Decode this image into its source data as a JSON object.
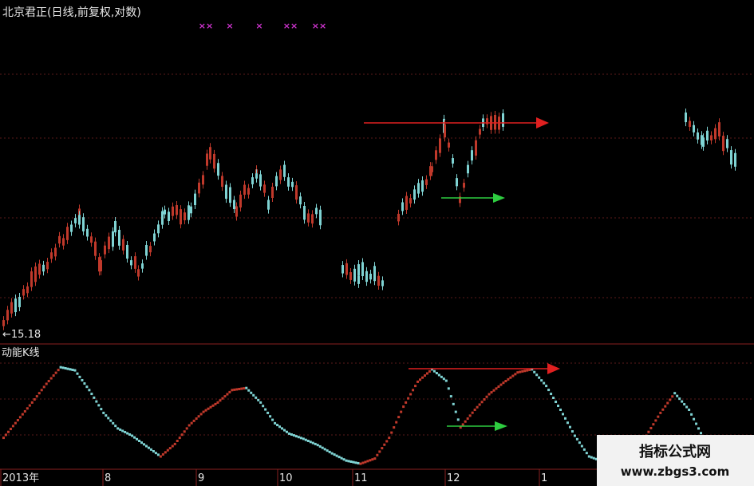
{
  "header": {
    "title": "北京君正(日线,前复权,对数)",
    "markers": [
      "××",
      "×",
      "×",
      "××",
      "××"
    ]
  },
  "main_panel": {
    "low_price_label": "←15.18"
  },
  "indicator_panel": {
    "title": "动能K线"
  },
  "x_axis": {
    "labels": [
      "2013年",
      "8",
      "9",
      "10",
      "11",
      "12",
      "1"
    ]
  },
  "watermark": {
    "text": "指标公式网",
    "url": "www.zbgs3.com"
  },
  "colors": {
    "background": "#000000",
    "up": "#c0392b",
    "down": "#7fd3d3",
    "arrow_red": "#e02020",
    "arrow_green": "#2ecc40",
    "marker": "#cc33cc"
  },
  "chart_data": [
    {
      "type": "candlestick",
      "title": "北京君正(日线,前复权,对数)",
      "x_labels": [
        "2013年",
        "8",
        "9",
        "10",
        "11",
        "12",
        "1"
      ],
      "annotations": [
        "←15.18"
      ],
      "note_arrows": [
        "resistance (red, right)",
        "support (green, right)"
      ]
    },
    {
      "type": "line",
      "title": "动能K线",
      "series": [
        {
          "values": [
            0.28,
            0.45,
            0.62,
            0.8,
            0.96,
            0.93,
            0.74,
            0.52,
            0.37,
            0.3,
            0.2,
            0.1,
            0.22,
            0.4,
            0.53,
            0.62,
            0.74,
            0.76,
            0.62,
            0.42,
            0.32,
            0.27,
            0.21,
            0.13,
            0.06,
            0.03,
            0.08,
            0.28,
            0.58,
            0.82,
            0.94,
            0.83,
            0.38,
            0.55,
            0.7,
            0.81,
            0.91,
            0.94,
            0.78,
            0.55,
            0.3,
            0.1,
            0.05,
            0.03,
            0.1,
            0.3,
            0.52,
            0.71,
            0.55,
            0.28
          ]
        }
      ]
    }
  ]
}
